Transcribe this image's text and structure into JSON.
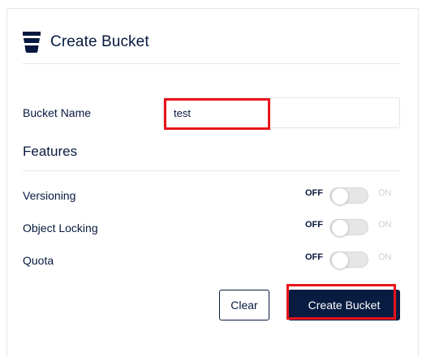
{
  "header": {
    "icon": "bucket-icon",
    "title": "Create Bucket"
  },
  "form": {
    "bucket_name_label": "Bucket Name",
    "bucket_name_value": "test"
  },
  "features": {
    "title": "Features",
    "items": [
      {
        "label": "Versioning",
        "off_label": "OFF",
        "on_label": "ON",
        "state": "off"
      },
      {
        "label": "Object Locking",
        "off_label": "OFF",
        "on_label": "ON",
        "state": "off"
      },
      {
        "label": "Quota",
        "off_label": "OFF",
        "on_label": "ON",
        "state": "off"
      }
    ]
  },
  "actions": {
    "clear_label": "Clear",
    "create_label": "Create Bucket"
  },
  "colors": {
    "primary_text": "#07193e",
    "primary_button": "#081c42",
    "highlight": "#e8141b",
    "divider": "#e5e5e5"
  }
}
